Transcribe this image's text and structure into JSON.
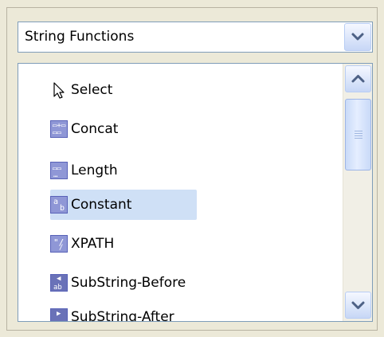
{
  "dropdown": {
    "selected": "String Functions",
    "icon": "chevron-down-icon"
  },
  "list": {
    "items": [
      {
        "label": "Select",
        "icon": "pointer-arrow-icon",
        "selected": false
      },
      {
        "label": "Concat",
        "icon": "concat-icon",
        "selected": false
      },
      {
        "label": "Length",
        "icon": "length-icon",
        "selected": false
      },
      {
        "label": "Constant",
        "icon": "constant-icon",
        "selected": true
      },
      {
        "label": "XPATH",
        "icon": "xpath-icon",
        "selected": false
      },
      {
        "label": "SubString-Before",
        "icon": "substring-before-icon",
        "selected": false
      },
      {
        "label": "SubString-After",
        "icon": "substring-after-icon",
        "selected": false
      }
    ]
  },
  "scrollbar": {
    "up_icon": "chevron-up-icon",
    "down_icon": "chevron-down-icon"
  },
  "colors": {
    "selection": "#cfe0f6",
    "icon_fill": "#8f97d6",
    "border": "#7f9db9"
  }
}
